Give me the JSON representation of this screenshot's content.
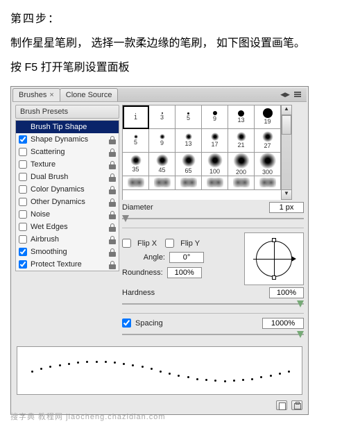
{
  "instructions": {
    "line1": "第四步：",
    "line2": "制作星星笔刷， 选择一款柔边缘的笔刷， 如下图设置画笔。",
    "line3": "按 F5 打开笔刷设置面板"
  },
  "panel": {
    "tabs": [
      {
        "label": "Brushes",
        "active": true,
        "closable": true
      },
      {
        "label": "Clone Source",
        "active": false,
        "closable": false
      }
    ],
    "presets_header": "Brush Presets",
    "options": [
      {
        "key": "brush_tip_shape",
        "label": "Brush Tip Shape",
        "selected": true,
        "checkbox": false,
        "locked": false
      },
      {
        "key": "shape_dynamics",
        "label": "Shape Dynamics",
        "checked": true,
        "locked": true
      },
      {
        "key": "scattering",
        "label": "Scattering",
        "checked": false,
        "locked": true
      },
      {
        "key": "texture",
        "label": "Texture",
        "checked": false,
        "locked": true
      },
      {
        "key": "dual_brush",
        "label": "Dual Brush",
        "checked": false,
        "locked": true
      },
      {
        "key": "color_dynamics",
        "label": "Color Dynamics",
        "checked": false,
        "locked": true
      },
      {
        "key": "other_dynamics",
        "label": "Other Dynamics",
        "checked": false,
        "locked": true
      },
      {
        "key": "noise",
        "label": "Noise",
        "checked": false,
        "locked": true
      },
      {
        "key": "wet_edges",
        "label": "Wet Edges",
        "checked": false,
        "locked": true
      },
      {
        "key": "airbrush",
        "label": "Airbrush",
        "checked": false,
        "locked": true
      },
      {
        "key": "smoothing",
        "label": "Smoothing",
        "checked": true,
        "locked": true
      },
      {
        "key": "protect_texture",
        "label": "Protect Texture",
        "checked": true,
        "locked": true
      }
    ],
    "brushes": {
      "row1": [
        1,
        3,
        5,
        9,
        13,
        19
      ],
      "row2": [
        5,
        9,
        13,
        17,
        21,
        27
      ],
      "row3": [
        35,
        45,
        65,
        100,
        200,
        300
      ],
      "row4_type": "texture"
    },
    "fields": {
      "diameter_label": "Diameter",
      "diameter_value": "1 px",
      "flip_x_label": "Flip X",
      "flip_x_checked": false,
      "flip_y_label": "Flip Y",
      "flip_y_checked": false,
      "angle_label": "Angle:",
      "angle_value": "0°",
      "roundness_label": "Roundness:",
      "roundness_value": "100%",
      "hardness_label": "Hardness",
      "hardness_value": "100%",
      "spacing_label": "Spacing",
      "spacing_checked": true,
      "spacing_value": "1000%"
    }
  },
  "watermark": "搜字典 教程网  jiaocheng.chazidian.com"
}
